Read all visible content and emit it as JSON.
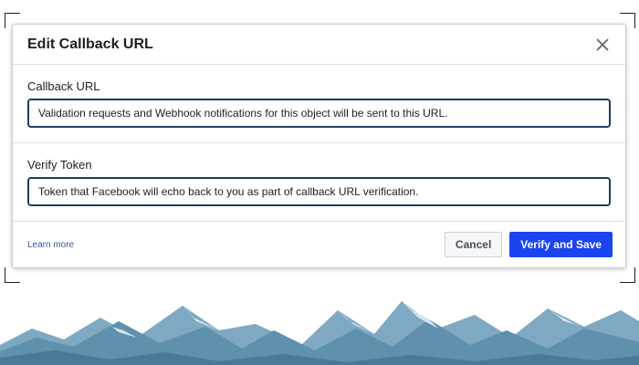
{
  "dialog": {
    "title": "Edit Callback URL",
    "close_icon": "close-icon"
  },
  "callback_url": {
    "label": "Callback URL",
    "placeholder": "Validation requests and Webhook notifications for this object will be sent to this URL."
  },
  "verify_token": {
    "label": "Verify Token",
    "placeholder": "Token that Facebook will echo back to you as part of callback URL verification."
  },
  "footer": {
    "learn_more": "Learn more",
    "cancel_label": "Cancel",
    "save_label": "Verify and Save"
  },
  "colors": {
    "primary_button": "#1a44f0",
    "input_border": "#23395d",
    "link": "#385898"
  }
}
